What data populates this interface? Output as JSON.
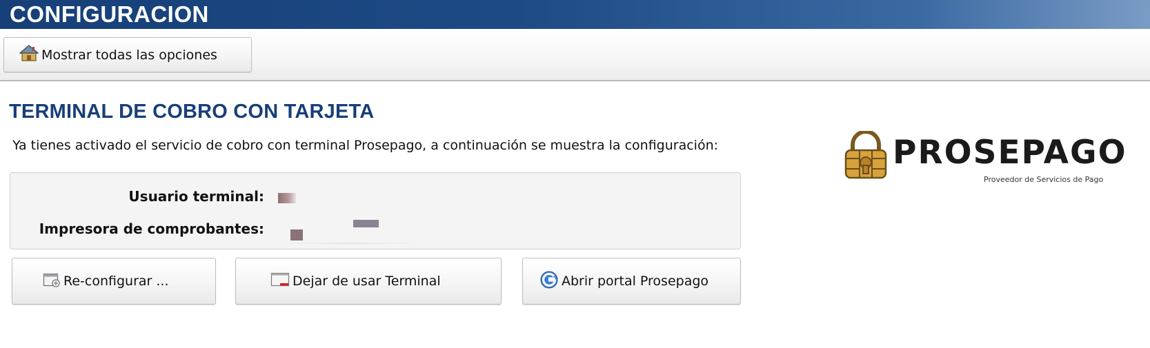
{
  "header": {
    "title": "CONFIGURACION"
  },
  "toolbar": {
    "home_button_label": "Mostrar todas las opciones"
  },
  "section": {
    "title": "TERMINAL DE COBRO CON TARJETA",
    "intro": "Ya tienes activado el servicio de cobro con terminal Prosepago, a continuación se muestra la configuración:"
  },
  "config": {
    "user_label": "Usuario terminal:",
    "printer_label": "Impresora de comprobantes:"
  },
  "actions": {
    "reconfigure_label": "Re-configurar ...",
    "stop_label": "Dejar de usar Terminal",
    "portal_label": "Abrir portal Prosepago"
  },
  "logo": {
    "wordmark": "PROSEPAGO",
    "tagline": "Proveedor de Servicios de Pago"
  },
  "icons": {
    "home": "house-icon",
    "reconfigure": "reconfigure-window-icon",
    "stop": "terminal-window-red-icon",
    "portal": "g-globe-icon",
    "logo": "padlock-chip-icon"
  },
  "colors": {
    "header_bg": "#173f78",
    "section_title": "#173f78",
    "panel_bg": "#f4f4f4"
  }
}
